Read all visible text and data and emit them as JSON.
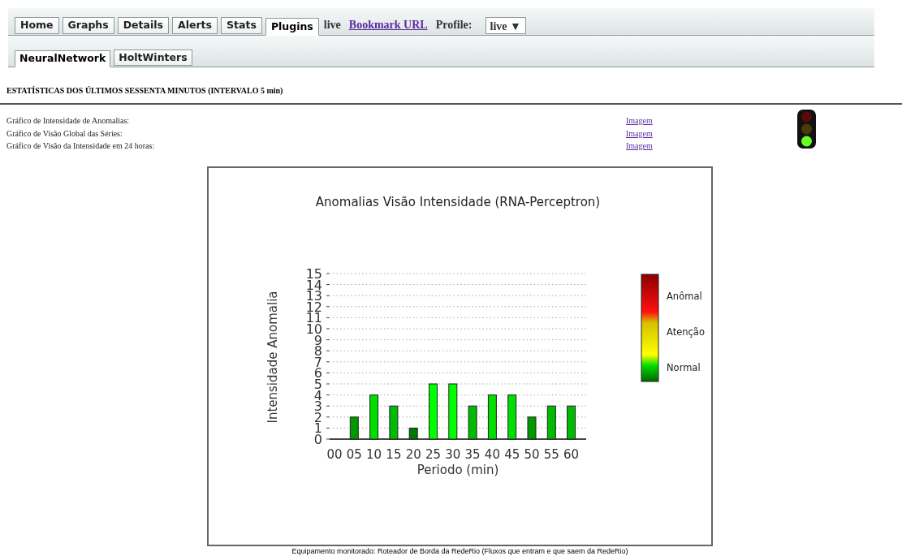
{
  "tabs": [
    {
      "label": "Home",
      "selected": false
    },
    {
      "label": "Graphs",
      "selected": false
    },
    {
      "label": "Details",
      "selected": false
    },
    {
      "label": "Alerts",
      "selected": false
    },
    {
      "label": "Stats",
      "selected": false
    },
    {
      "label": "Plugins",
      "selected": true
    }
  ],
  "live_label": "live",
  "bookmark_link": "Bookmark URL",
  "profile_label": "Profile:",
  "profile_select": {
    "value": "live ▼"
  },
  "subtabs": [
    {
      "label": "NeuralNetwork",
      "selected": true
    },
    {
      "label": "HoltWinters",
      "selected": false
    }
  ],
  "heading": "ESTATÍSTICAS DOS ÚLTIMOS SESSENTA MINUTOS (INTERVALO 5 min)",
  "rows": [
    {
      "label": "Gráfico de Intensidade de Anomalias:",
      "link": "Imagem"
    },
    {
      "label": "Gráfico de Visão Global das Séries:",
      "link": "Imagem"
    },
    {
      "label": "Gráfico de Visão da Intensidade em 24 horas:",
      "link": "Imagem"
    }
  ],
  "traffic_light": {
    "red_on": false,
    "yellow_on": false,
    "green_on": true
  },
  "chart": {
    "chart_data": {
      "type": "bar",
      "title": "Anomalias Visão Intensidade (RNA-Perceptron)",
      "xlabel": "Periodo (min)",
      "ylabel": "Intensidade Anomalia",
      "categories": [
        "00",
        "05",
        "10",
        "15",
        "20",
        "25",
        "30",
        "35",
        "40",
        "45",
        "50",
        "55",
        "60"
      ],
      "series": [
        {
          "values": [
            null,
            2,
            4,
            3,
            1,
            5,
            5,
            3,
            4,
            4,
            2,
            3,
            3
          ]
        }
      ],
      "grid": true,
      "ylim": [
        0,
        15
      ],
      "yticks": [
        0,
        1,
        2,
        3,
        4,
        5,
        6,
        7,
        8,
        9,
        10,
        11,
        12,
        13,
        14,
        15
      ]
    },
    "legend": [
      "Anômal",
      "Atenção",
      "Normal"
    ]
  },
  "caption": "Equipamento monitorado: Roteador de Borda da RedeRio (Fluxos que entram e que saem da RedeRio)"
}
